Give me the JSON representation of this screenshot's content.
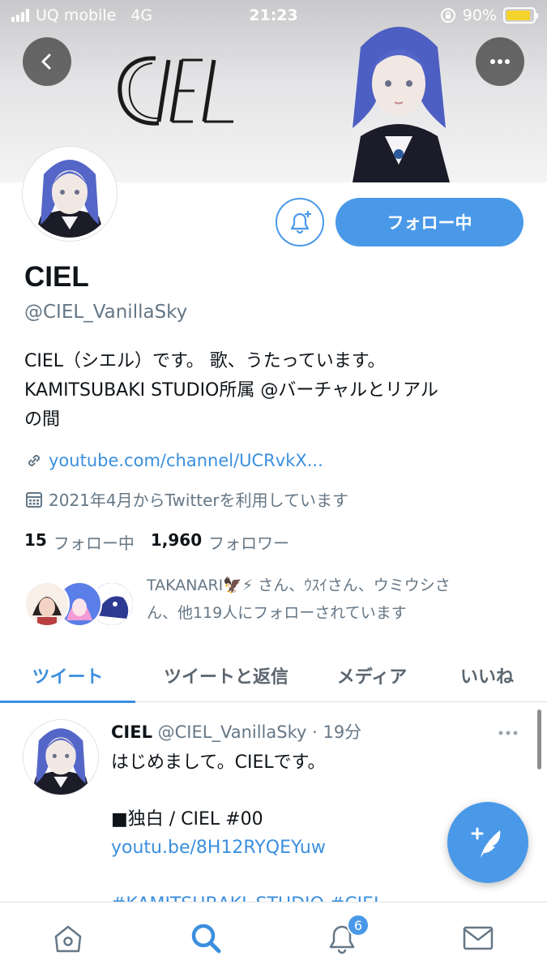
{
  "status_bar": {
    "carrier": "UQ mobile",
    "network": "4G",
    "time": "21:23",
    "battery": "90%",
    "battery_level": 0.9
  },
  "banner": {
    "logo_text": "CIEL",
    "back_icon": "chevron-left-icon",
    "more_icon": "more-horizontal-icon"
  },
  "profile": {
    "name": "CIEL",
    "handle": "@CIEL_VanillaSky",
    "bio_line1": "CIEL（シエル）です。 歌、うたっています。",
    "bio_line2": "KAMITSUBAKI STUDIO所属 @バーチャルとリアル",
    "bio_line3": "の間",
    "link": "youtube.com/channel/UCRvkX...",
    "joined": "2021年4月からTwitterを利用しています",
    "following_count": "15",
    "following_label": "フォロー中",
    "followers_count": "1,960",
    "followers_label": "フォロワー",
    "follow_button": "フォロー中",
    "followed_by_line1": "TAKANARI🦅⚡ さん、ｳｽｲさん、ウミウシさ",
    "followed_by_line2": "ん、他119人にフォローされています"
  },
  "tabs": [
    {
      "label": "ツイート",
      "active": true
    },
    {
      "label": "ツイートと返信",
      "active": false
    },
    {
      "label": "メディア",
      "active": false
    },
    {
      "label": "いいね",
      "active": false
    }
  ],
  "tweet": {
    "name": "CIEL",
    "handle": "@CIEL_VanillaSky",
    "time": "· 19分",
    "line1": "はじめまして。CIELです。",
    "line2": "■独白 / CIEL #00",
    "link": "youtu.be/8H12RYQEYuw",
    "hashtags": "#KAMITSUBAKI_STUDIO #CIEL"
  },
  "bottom_nav": {
    "notification_badge": "6",
    "items": [
      "home-icon",
      "search-icon",
      "bell-icon",
      "mail-icon"
    ]
  },
  "colors": {
    "accent": "#4a99e9",
    "link": "#3b8fde",
    "secondary_text": "#657786"
  }
}
